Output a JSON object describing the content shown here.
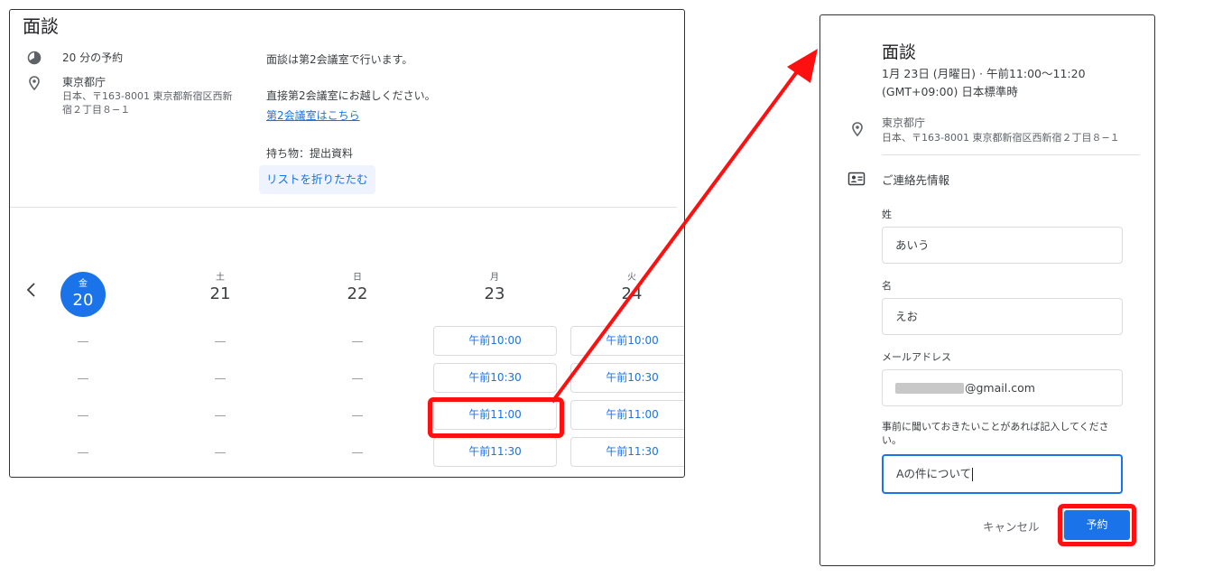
{
  "booking": {
    "title": "面談",
    "duration": "20 分の予約",
    "location_name": "東京都庁",
    "location_address": "日本、〒163-8001 東京都新宿区西新宿２丁目８−１",
    "description_line1": "面談は第2会議室で行います。",
    "description_line2": "直接第2会議室にお越しください。",
    "description_link": "第2会議室はこちら",
    "description_line3": "持ち物：提出資料",
    "collapse_label": "リストを折りたたむ"
  },
  "calendar": {
    "prev_icon": "chevron-left-icon",
    "days": [
      {
        "dow": "金",
        "num": "20",
        "selected": true
      },
      {
        "dow": "土",
        "num": "21"
      },
      {
        "dow": "日",
        "num": "22"
      },
      {
        "dow": "月",
        "num": "23"
      },
      {
        "dow": "火",
        "num": "24"
      }
    ],
    "empty_slot": "—",
    "slots": [
      "午前10:00",
      "午前10:30",
      "午前11:00",
      "午前11:30"
    ]
  },
  "form": {
    "title": "面談",
    "date": "1月 23日 (月曜日) · 午前11:00～11:20",
    "timezone": "(GMT+09:00) 日本標準時",
    "location_name": "東京都庁",
    "location_address": "日本、〒163-8001 東京都新宿区西新宿２丁目８−１",
    "contact_label": "ご連絡先情報",
    "last_name_label": "姓",
    "last_name_value": "あいう",
    "first_name_label": "名",
    "first_name_value": "えお",
    "email_label": "メールアドレス",
    "email_value": "@gmail.com",
    "notes_label": "事前に聞いておきたいことがあれば記入してください。",
    "notes_value": "Aの件について",
    "cancel_label": "キャンセル",
    "submit_label": "予約"
  },
  "colors": {
    "accent": "#1a73e8",
    "highlight": "#ff1010"
  }
}
